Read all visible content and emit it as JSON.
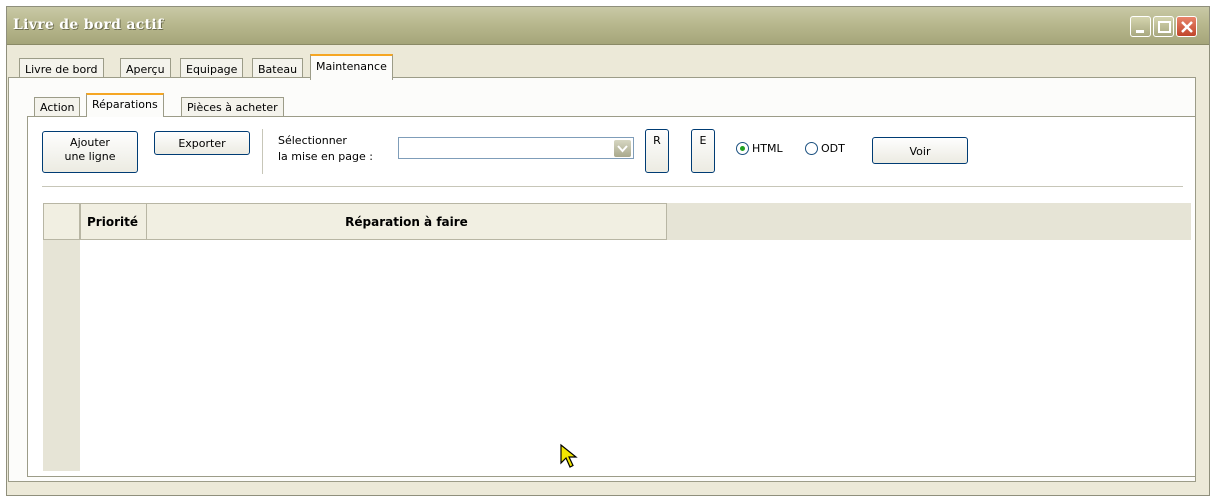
{
  "window": {
    "title": "Livre de bord actif"
  },
  "outer_tabs": [
    {
      "label": "Livre de bord"
    },
    {
      "label": "Aperçu"
    },
    {
      "label": "Equipage"
    },
    {
      "label": "Bateau"
    },
    {
      "label": "Maintenance",
      "active": true
    }
  ],
  "inner_tabs": [
    {
      "label": "Action"
    },
    {
      "label": "Réparations",
      "active": true
    },
    {
      "label": "Pièces à acheter"
    }
  ],
  "toolbar": {
    "add_line_label_1": "Ajouter",
    "add_line_label_2": "une ligne",
    "export_label": "Exporter",
    "layout_label_1": "Sélectionner",
    "layout_label_2": "la mise en page :",
    "layout_value": "",
    "r_label": "R",
    "e_label": "E",
    "format_options": [
      {
        "label": "HTML",
        "selected": true
      },
      {
        "label": "ODT",
        "selected": false
      }
    ],
    "view_label": "Voir"
  },
  "grid": {
    "columns": [
      "Priorité",
      "Réparation à faire"
    ],
    "rows": []
  },
  "colors": {
    "titlebar": "#b8b88e",
    "active_tab_accent": "#f5a623",
    "close_button": "#c0452a",
    "radio_checked": "#21a121"
  }
}
